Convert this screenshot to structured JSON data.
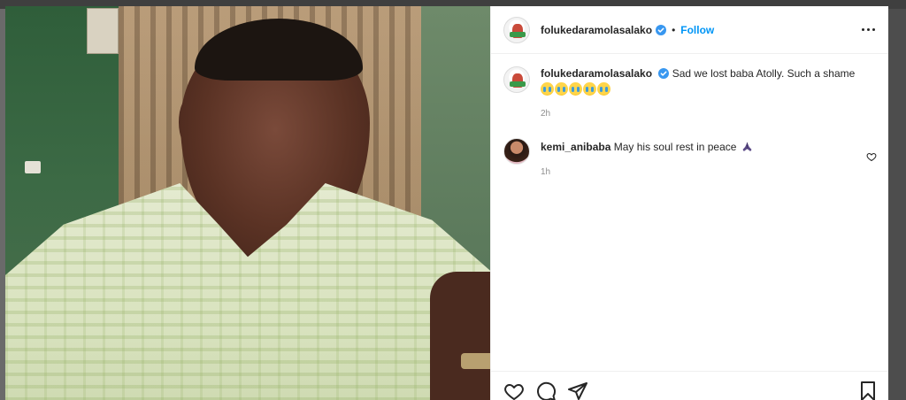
{
  "post": {
    "author": {
      "username": "folukedaramolasalako",
      "verified": true
    },
    "follow_label": "Follow",
    "separator": "•",
    "caption": {
      "username": "folukedaramolasalako",
      "text": "Sad we lost baba Atolly. Such a shame",
      "emoji_count": 5,
      "time": "2h"
    },
    "comments": [
      {
        "username": "kemi_anibaba",
        "text": "May his soul rest in peace",
        "emoji": "folded-hands",
        "time": "1h"
      }
    ]
  },
  "icons": {
    "more": "more-horizontal-icon",
    "verified": "verified-badge-icon",
    "like": "heart-icon",
    "comment": "comment-bubble-icon",
    "share": "paper-plane-icon",
    "save": "bookmark-icon"
  },
  "colors": {
    "link_blue": "#0095f6",
    "verified_blue": "#3897f0",
    "text": "#262626",
    "muted": "#8e8e8e"
  }
}
